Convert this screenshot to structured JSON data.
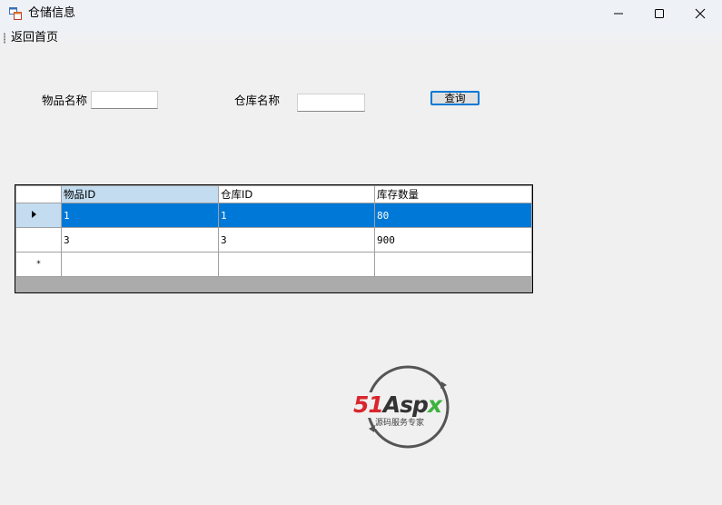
{
  "window": {
    "title": "仓储信息",
    "minimize_icon": "minimize-icon",
    "maximize_icon": "maximize-icon",
    "close_icon": "close-icon"
  },
  "menu": {
    "items": [
      {
        "label": "返回首页"
      }
    ]
  },
  "search": {
    "item_name_label": "物品名称",
    "item_name_value": "",
    "warehouse_name_label": "仓库名称",
    "warehouse_name_value": "",
    "query_button": "查询"
  },
  "grid": {
    "columns": [
      "物品ID",
      "仓库ID",
      "库存数量"
    ],
    "rows": [
      {
        "item_id": "1",
        "warehouse_id": "1",
        "quantity": "80",
        "selected": true
      },
      {
        "item_id": "3",
        "warehouse_id": "3",
        "quantity": "900",
        "selected": false
      }
    ],
    "new_row_marker": "*",
    "selection_color": "#0078d7"
  },
  "watermark": {
    "brand_51": "51",
    "brand_asp": "Asp",
    "brand_x": "x",
    "tagline": "源码服务专家",
    "colors": {
      "red": "#d9262c",
      "dark": "#333333",
      "green": "#3db23d"
    }
  }
}
